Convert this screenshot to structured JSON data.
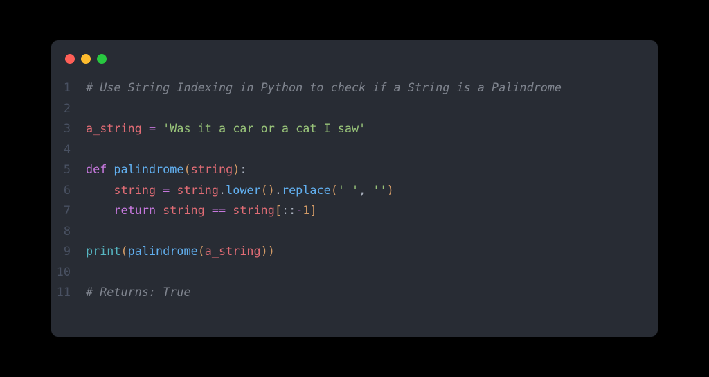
{
  "window": {
    "dots": [
      "red",
      "yellow",
      "green"
    ]
  },
  "gutter": {
    "1": "1",
    "2": "2",
    "3": "3",
    "4": "4",
    "5": "5",
    "6": "6",
    "7": "7",
    "8": "8",
    "9": "9",
    "10": "10",
    "11": "11"
  },
  "line1": {
    "comment": "# Use String Indexing in Python to check if a String is a Palindrome"
  },
  "line3": {
    "var": "a_string",
    "sp1": " ",
    "assign": "=",
    "sp2": " ",
    "str": "'Was it a car or a cat I saw'"
  },
  "line5": {
    "kw": "def",
    "sp": " ",
    "fn": "palindrome",
    "lparen": "(",
    "param": "string",
    "rparen": ")",
    "colon": ":"
  },
  "line6": {
    "indent": "    ",
    "lhs": "string",
    "sp1": " ",
    "assign": "=",
    "sp2": " ",
    "rhs": "string",
    "dot1": ".",
    "m1": "lower",
    "lp1": "(",
    "rp1": ")",
    "dot2": ".",
    "m2": "replace",
    "lp2": "(",
    "arg1": "' '",
    "comma": ",",
    "sp3": " ",
    "arg2": "''",
    "rp2": ")"
  },
  "line7": {
    "indent": "    ",
    "kw": "return",
    "sp1": " ",
    "lhs": "string",
    "sp2": " ",
    "eq": "==",
    "sp3": " ",
    "rhs": "string",
    "lbrack": "[",
    "colon1": ":",
    "colon2": ":",
    "neg": "-",
    "num": "1",
    "rbrack": "]"
  },
  "line9": {
    "fn": "print",
    "lp1": "(",
    "call": "palindrome",
    "lp2": "(",
    "arg": "a_string",
    "rp2": ")",
    "rp1": ")"
  },
  "line11": {
    "comment": "# Returns: True"
  }
}
